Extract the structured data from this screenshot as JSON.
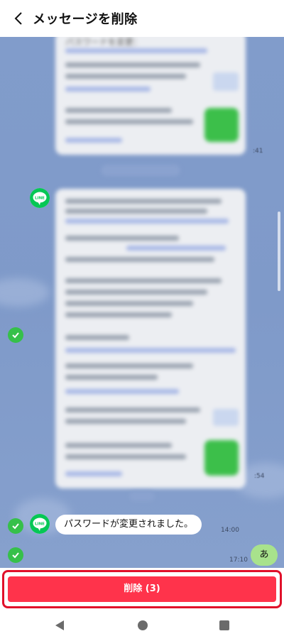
{
  "header": {
    "title": "メッセージを削除"
  },
  "messages": {
    "blurred_header_fragment": "パスワードを変更：",
    "time_1": ":41",
    "time_2": ":54",
    "text_message": "パスワードが変更されました。",
    "text_time": "14:00",
    "my_message": "あ",
    "my_time": "17:10"
  },
  "avatar": {
    "label": "LINE"
  },
  "actions": {
    "delete_label": "削除 (3)"
  },
  "colors": {
    "delete_button": "#ff334b",
    "check_green": "#36c04a",
    "line_green": "#06c755",
    "chat_background": "#7e98c8",
    "outline_red": "#e0102a"
  }
}
